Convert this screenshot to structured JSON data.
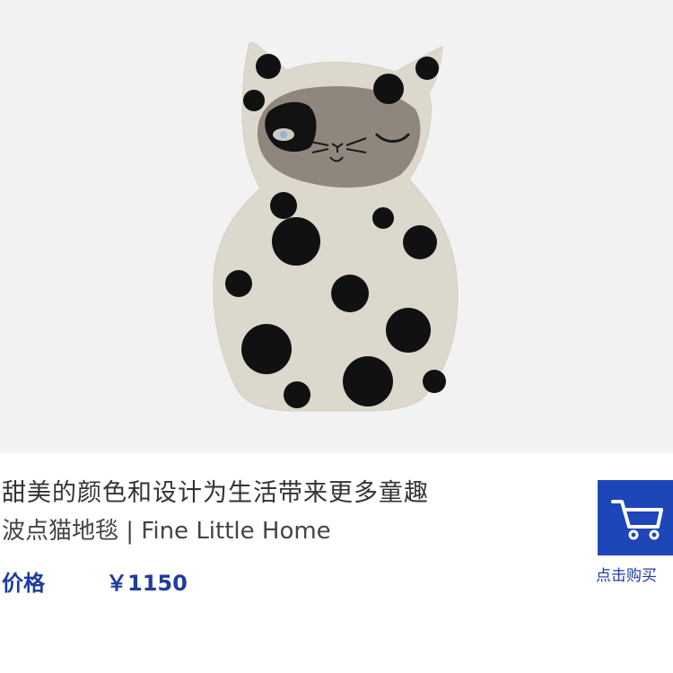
{
  "product": {
    "title": "甜美的颜色和设计为生活带来更多童趣",
    "subtitle": "波点猫地毯 | Fine Little Home",
    "price_label": "价格",
    "price_value": "￥1150",
    "image_alt_icon": "spotted-cat-rug"
  },
  "cart": {
    "label": "点击购买",
    "icon": "shopping-cart-icon"
  },
  "colors": {
    "accent": "#1d46b8",
    "text_blue": "#1f3c9e",
    "rug_base": "#ddd7cc",
    "rug_face": "#8f877d",
    "spots": "#111111"
  }
}
